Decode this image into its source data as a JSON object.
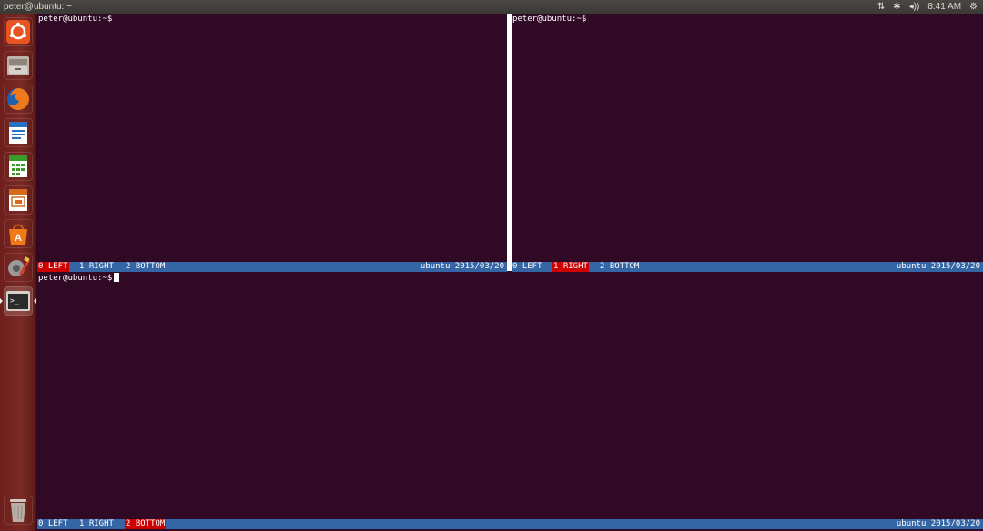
{
  "top_panel": {
    "title": "peter@ubuntu: ~",
    "network_icon": "⇅",
    "bluetooth_icon": "✱",
    "volume_icon": "◂))",
    "clock": "8:41 AM",
    "settings_icon": "⚙"
  },
  "launcher": {
    "items": [
      {
        "name": "ubuntu-dash",
        "glyph": "◉",
        "color": "#e95420"
      },
      {
        "name": "files",
        "glyph": "▭",
        "color": "#9a8e82"
      },
      {
        "name": "firefox",
        "glyph": "●",
        "color": "#e66000"
      },
      {
        "name": "libreoffice-writer",
        "glyph": "≡",
        "color": "#2a72c1"
      },
      {
        "name": "libreoffice-calc",
        "glyph": "▦",
        "color": "#3a9a2a"
      },
      {
        "name": "libreoffice-impress",
        "glyph": "▣",
        "color": "#d26b1e"
      },
      {
        "name": "software-center",
        "glyph": "A",
        "color": "#e95420"
      },
      {
        "name": "system-settings",
        "glyph": "✎",
        "color": "#c0392b"
      },
      {
        "name": "terminal",
        "glyph": ">_",
        "color": "#2d2d2d"
      },
      {
        "name": "trash",
        "glyph": "🗑",
        "color": "#5a4c44"
      }
    ]
  },
  "panes": {
    "left": {
      "prompt": "peter@ubuntu:~$"
    },
    "right": {
      "prompt": "peter@ubuntu:~$"
    },
    "bottom": {
      "prompt": "peter@ubuntu:~$"
    }
  },
  "status": {
    "windows": [
      "0 LEFT",
      "1 RIGHT",
      "2 BOTTOM"
    ],
    "host_date": "ubuntu 2015/03/20"
  },
  "colors": {
    "terminal_bg": "#300a24",
    "status_bg": "#3465a4",
    "active_window": "#cc0000"
  }
}
